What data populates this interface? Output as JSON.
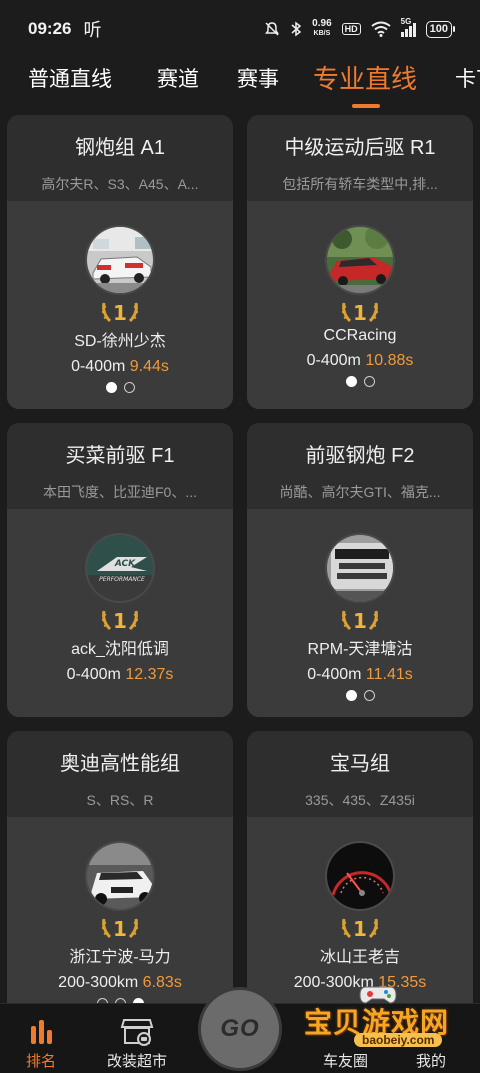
{
  "status_bar": {
    "time": "09:26",
    "hd_icon_text": "听",
    "speed_value": "0.96",
    "speed_unit": "KB/S",
    "hd_badge": "HD",
    "network": "5G",
    "battery": "100"
  },
  "tabs": [
    {
      "label": "普通直线",
      "active": false
    },
    {
      "label": "赛道",
      "active": false
    },
    {
      "label": "赛事",
      "active": false
    },
    {
      "label": "专业直线",
      "active": true
    },
    {
      "label": "卡丁",
      "active": false
    }
  ],
  "accent_color": "#ef7b2f",
  "time_color": "#ef9a3c",
  "cards": [
    {
      "title": "钢炮组 A1",
      "subtitle": "高尔夫R、S3、A45、A...",
      "rank": "1",
      "champion": "SD-徐州少杰",
      "distance": "0-400m",
      "time": "9.44s",
      "dots": [
        true,
        false
      ],
      "avatar_icon": "white-race-car-photo"
    },
    {
      "title": "中级运动后驱 R1",
      "subtitle": "包括所有轿车类型中,排...",
      "rank": "1",
      "champion": "CCRacing",
      "distance": "0-400m",
      "time": "10.88s",
      "dots": [
        true,
        false
      ],
      "avatar_icon": "red-sedan-photo"
    },
    {
      "title": "买菜前驱 F1",
      "subtitle": "本田飞度、比亚迪F0、...",
      "rank": "1",
      "champion": "ack_沈阳低调",
      "distance": "0-400m",
      "time": "12.37s",
      "dots": [],
      "avatar_icon": "ack-performance-logo"
    },
    {
      "title": "前驱钢炮 F2",
      "subtitle": "尚酷、高尔夫GTI、福克...",
      "rank": "1",
      "champion": "RPM-天津塘沽",
      "distance": "0-400m",
      "time": "11.41s",
      "dots": [
        true,
        false
      ],
      "avatar_icon": "rear-window-sticker-photo"
    },
    {
      "title": "奥迪高性能组",
      "subtitle": "S、RS、R",
      "rank": "1",
      "champion": "浙江宁波-马力",
      "distance": "200-300km",
      "time": "6.83s",
      "dots": [
        false,
        false,
        true
      ],
      "avatar_icon": "white-audi-photo"
    },
    {
      "title": "宝马组",
      "subtitle": "335、435、Z435i",
      "rank": "1",
      "champion": "冰山王老吉",
      "distance": "200-300km",
      "time": "15.35s",
      "dots": [],
      "avatar_icon": "dashboard-gauge-photo"
    }
  ],
  "bottom_nav": {
    "ranking": "排名",
    "shop": "改装超市",
    "go": "GO",
    "friends": "车友圈",
    "mine": "我的"
  },
  "watermark": {
    "text": "宝贝游戏网",
    "url": "baobeiy.com"
  }
}
